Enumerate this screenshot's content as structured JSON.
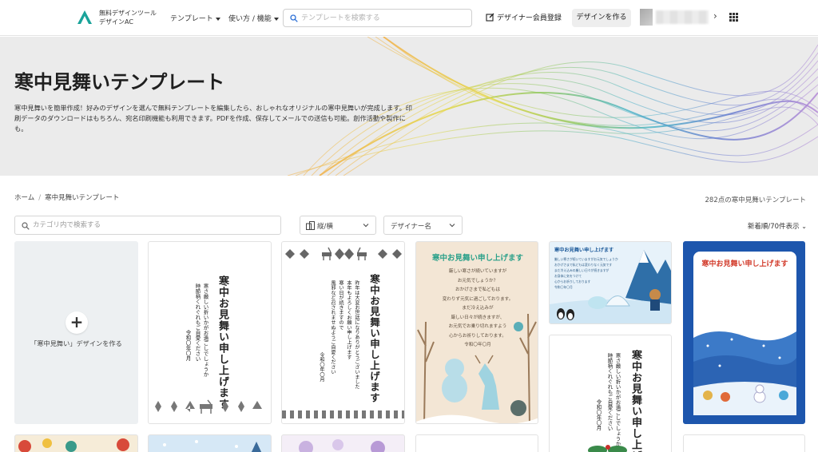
{
  "header": {
    "logo_line1": "無料デザインツール",
    "logo_line2": "デザインAC",
    "nav_templates": "テンプレート",
    "nav_howto": "使い方 / 機能",
    "search_placeholder": "テンプレートを検索する",
    "register_label": "デザイナー会員登録",
    "create_label": "デザインを作る"
  },
  "hero": {
    "title": "寒中見舞いテンプレート",
    "description": "寒中見舞いを簡単作成！好みのデザインを選んで無料テンプレートを編集したら、おしゃれなオリジナルの寒中見舞いが完成します。印刷データのダウンロードはもちろん、宛名印刷機能も利用できます。PDFを作成、保存してメールでの送信も可能。創作活動や製作にも。"
  },
  "breadcrumb": {
    "home": "ホーム",
    "current": "寒中見舞いテンプレート"
  },
  "result_count": "282点の寒中見舞いテンプレート",
  "filters": {
    "category_placeholder": "カテゴリ内で検索する",
    "orientation_label": "縦/横",
    "designer_label": "デザイナー名",
    "sort_label": "新着順/70件表示"
  },
  "create_card": {
    "label": "「寒中見舞い」デザインを作る"
  },
  "cards": {
    "c2": {
      "title": "寒中お見舞い申し上げます",
      "body1": "寒さ厳しい折いかがお過ごしでしょうか",
      "body2": "時節柄くれぐれもご自愛ください",
      "date": "令和〇年〇月"
    },
    "c3": {
      "title": "寒中お見舞い申し上げます",
      "body1": "昨年は大変お世話になりありがとうございました",
      "body2": "本年もよろしくお願い申し上げます",
      "body3": "寒い日が続きますので",
      "body4": "風邪など召されませぬようご自愛ください",
      "date": "令和〇年〇月"
    },
    "c4": {
      "title": "寒中お見舞い申し上げます",
      "lines": [
        "厳しい寒さが続いていますが",
        "お元気でしょうか？",
        "おかげさまで私どもは",
        "変わりず元気に過ごしております。",
        "まだ冷え込みが",
        "厳しい日々が続きますが、",
        "お元気でお乗り切れますよう",
        "心からお祈りしております。",
        "令和〇年〇月"
      ]
    },
    "c5": {
      "title": "寒中お見舞い申し上げます",
      "lines": [
        "厳しい寒さが続いていますがお元気でしょうか",
        "おかげさまで私どもは変わりなく元気です",
        "まだ冷え込みの厳しい日々が続きますが",
        "お身体に気をつけて",
        "心からお祈りしております",
        "令和〇年〇月"
      ]
    },
    "c6": {
      "title": "寒中お見舞い申し上げます"
    },
    "c7": {
      "title": "寒中お見舞い申し上げます",
      "body1": "寒さ厳しい折いかがお過ごしでしょうか",
      "body2": "時節柄くれぐれもご自愛ください",
      "date": "令和〇年〇月"
    }
  },
  "colors": {
    "accent_teal": "#1aa39a",
    "header_border": "#e4e4e4",
    "hero_bg": "#ebebeb",
    "create_card_bg": "#edf0f2",
    "card_red_title": "#d23a2a",
    "card_blue": "#2060b8"
  },
  "icons": {
    "logo": "logo-mark",
    "search": "search-icon",
    "register": "pen-square-icon",
    "apps": "grid-icon",
    "next": "chevron-right-icon",
    "add": "plus-icon"
  }
}
